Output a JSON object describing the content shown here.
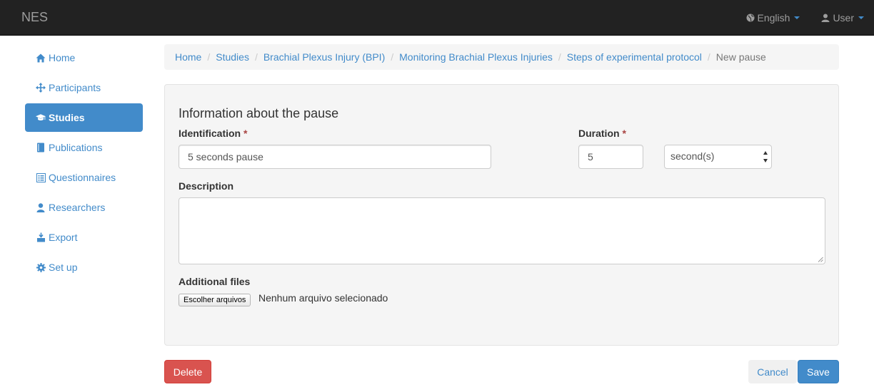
{
  "navbar": {
    "brand": "NES",
    "language": {
      "label": "English",
      "icon": "globe-icon"
    },
    "user": {
      "label": "User",
      "icon": "user-icon"
    }
  },
  "sidebar": {
    "items": [
      {
        "label": "Home",
        "icon": "home-icon",
        "active": false
      },
      {
        "label": "Participants",
        "icon": "move-icon",
        "active": false
      },
      {
        "label": "Studies",
        "icon": "graduation-cap-icon",
        "active": true
      },
      {
        "label": "Publications",
        "icon": "book-icon",
        "active": false
      },
      {
        "label": "Questionnaires",
        "icon": "list-icon",
        "active": false
      },
      {
        "label": "Researchers",
        "icon": "user-icon",
        "active": false
      },
      {
        "label": "Export",
        "icon": "export-icon",
        "active": false
      },
      {
        "label": "Set up",
        "icon": "cog-icon",
        "active": false
      }
    ]
  },
  "breadcrumb": {
    "items": [
      "Home",
      "Studies",
      "Brachial Plexus Injury (BPI)",
      "Monitoring Brachial Plexus Injuries",
      "Steps of experimental protocol",
      "New pause"
    ]
  },
  "form": {
    "title": "Information about the pause",
    "identification": {
      "label": "Identification",
      "required_mark": "*",
      "value": "5 seconds pause"
    },
    "duration": {
      "label": "Duration",
      "required_mark": "*",
      "value": "5",
      "unit": "second(s)"
    },
    "description": {
      "label": "Description",
      "value": ""
    },
    "additional_files": {
      "label": "Additional files",
      "button": "Escolher arquivos",
      "status": "Nenhum arquivo selecionado"
    }
  },
  "actions": {
    "delete": "Delete",
    "cancel": "Cancel",
    "save": "Save"
  },
  "colors": {
    "primary": "#428bca",
    "danger": "#d9534f",
    "navbar": "#222222",
    "panel": "#f5f5f5",
    "required": "#a94442"
  }
}
